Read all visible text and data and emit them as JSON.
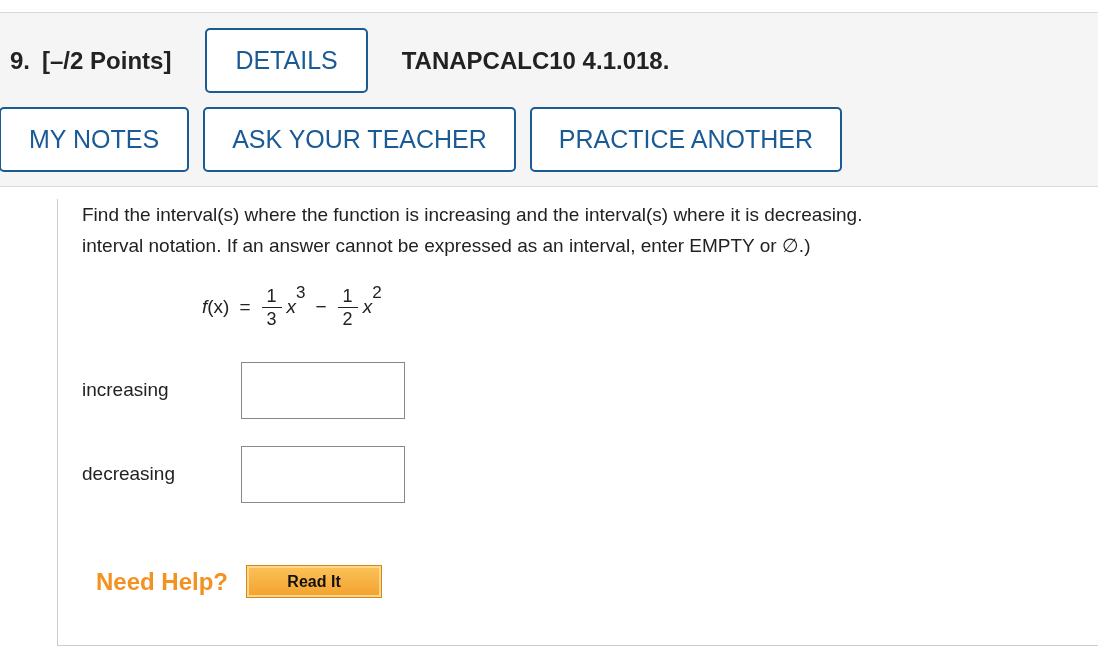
{
  "question": {
    "number": "9.",
    "points": "[–/2 Points]",
    "details_button": "DETAILS",
    "code": "TANAPCALC10 4.1.018."
  },
  "action_buttons": [
    {
      "label": "MY NOTES"
    },
    {
      "label": "ASK YOUR TEACHER"
    },
    {
      "label": "PRACTICE ANOTHER"
    }
  ],
  "instruction_lines": [
    "Find the interval(s) where the function is increasing and the interval(s) where it is decreasing.",
    "interval notation. If an answer cannot be expressed as an interval, enter EMPTY or ∅.)"
  ],
  "formula": {
    "lhs": "*f*(x)",
    "equals": "=",
    "terms": [
      {
        "numerator": "1",
        "denominator": "3",
        "variable": "x",
        "exponent": "3"
      },
      {
        "sign": "−",
        "numerator": "1",
        "denominator": "2",
        "variable": "x",
        "exponent": "2"
      }
    ]
  },
  "answers": [
    {
      "label": "increasing"
    },
    {
      "label": "decreasing"
    }
  ],
  "help": {
    "label": "Need Help?",
    "button": "Read It"
  }
}
